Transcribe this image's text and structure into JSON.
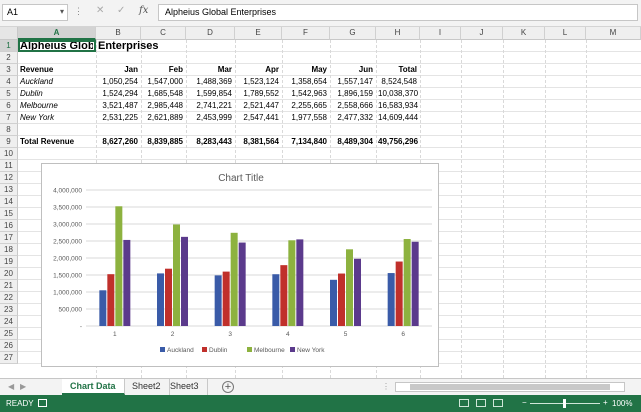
{
  "name_box": "A1",
  "formula": "Alpheius Global Enterprises",
  "columns": [
    "A",
    "B",
    "C",
    "D",
    "E",
    "F",
    "G",
    "H",
    "I",
    "J",
    "K",
    "L",
    "M"
  ],
  "rows": [
    "1",
    "2",
    "3",
    "4",
    "5",
    "6",
    "7",
    "8",
    "9",
    "10",
    "11",
    "12",
    "13",
    "14",
    "15",
    "16",
    "17",
    "18",
    "19",
    "20",
    "21",
    "22",
    "23",
    "24",
    "25",
    "26",
    "27"
  ],
  "sheet": {
    "title_part1": "Alpheius Globa",
    "title_part2": "Enterprises",
    "header": [
      "Revenue",
      "Jan",
      "Feb",
      "Mar",
      "Apr",
      "May",
      "Jun",
      "Total"
    ],
    "data_rows": [
      [
        "Auckland",
        "1,050,254",
        "1,547,000",
        "1,488,369",
        "1,523,124",
        "1,358,654",
        "1,557,147",
        "8,524,548"
      ],
      [
        "Dublin",
        "1,524,294",
        "1,685,548",
        "1,599,854",
        "1,789,552",
        "1,542,963",
        "1,896,159",
        "10,038,370"
      ],
      [
        "Melbourne",
        "3,521,487",
        "2,985,448",
        "2,741,221",
        "2,521,447",
        "2,255,665",
        "2,558,666",
        "16,583,934"
      ],
      [
        "New York",
        "2,531,225",
        "2,621,889",
        "2,453,999",
        "2,547,441",
        "1,977,558",
        "2,477,332",
        "14,609,444"
      ]
    ],
    "total_row": [
      "Total Revenue",
      "8,627,260",
      "8,839,885",
      "8,283,443",
      "8,381,564",
      "7,134,840",
      "8,489,304",
      "49,756,296"
    ]
  },
  "chart_data": {
    "type": "bar",
    "title": "Chart Title",
    "categories": [
      "1",
      "2",
      "3",
      "4",
      "5",
      "6"
    ],
    "series": [
      {
        "name": "Auckland",
        "values": [
          1050254,
          1547000,
          1488369,
          1523124,
          1358654,
          1557147
        ]
      },
      {
        "name": "Dublin",
        "values": [
          1524294,
          1685548,
          1599854,
          1789552,
          1542963,
          1896159
        ]
      },
      {
        "name": "Melbourne",
        "values": [
          3521487,
          2985448,
          2741221,
          2521447,
          2255665,
          2558666
        ]
      },
      {
        "name": "New York",
        "values": [
          2531225,
          2621889,
          2453999,
          2547441,
          1977558,
          2477332
        ]
      }
    ],
    "colors": [
      "#3a5ba8",
      "#c0302b",
      "#8db23f",
      "#5b3a8c"
    ],
    "ylim": [
      0,
      4000000
    ],
    "yticks": [
      "-",
      "500,000",
      "1,000,000",
      "1,500,000",
      "2,000,000",
      "2,500,000",
      "3,000,000",
      "3,500,000",
      "4,000,000"
    ],
    "grid": true,
    "legend": "bottom"
  },
  "tabs": [
    "Chart Data",
    "Sheet2",
    "Sheet3"
  ],
  "active_tab": "Chart Data",
  "status": {
    "ready": "READY",
    "zoom": "100%"
  },
  "icons": {
    "cancel": "close-icon",
    "enter": "check-icon",
    "function": "fx-icon",
    "add_sheet": "plus-icon"
  }
}
